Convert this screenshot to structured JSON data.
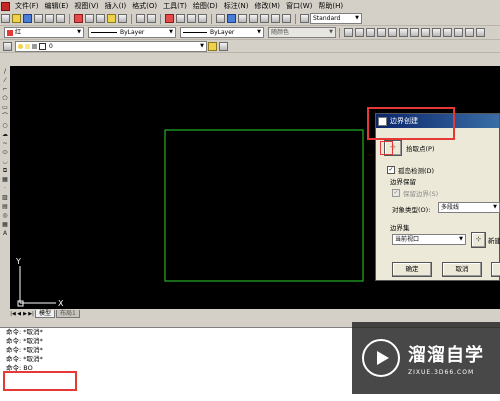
{
  "menubar": {
    "items": [
      "文件(F)",
      "编辑(E)",
      "视图(V)",
      "插入(I)",
      "格式(O)",
      "工具(T)",
      "绘图(D)",
      "标注(N)",
      "修改(M)",
      "窗口(W)",
      "帮助(H)"
    ]
  },
  "toolbar": {
    "text_style": "Standard"
  },
  "properties": {
    "color_value": "红",
    "linetype_value": "ByLayer",
    "lineweight_value": "ByLayer",
    "plotstyle_value": "随颜色"
  },
  "layers": {
    "current_layer": "0"
  },
  "ucs": {
    "x_label": "X",
    "y_label": "Y"
  },
  "tabs": {
    "model": "模型",
    "layout": "布局1"
  },
  "command_history": [
    "命令: *取消*",
    "命令: *取消*",
    "命令: *取消*",
    "命令: *取消*"
  ],
  "command_prompt": "命令: BO",
  "dialog": {
    "title": "边界创建",
    "pick_points_label": "拾取点(P)",
    "island_detection_label": "孤岛检测(D)",
    "boundary_retention_label": "边界保留",
    "retain_boundaries_label": "保留边界(S)",
    "object_type_label": "对象类型(O):",
    "object_type_value": "多段线",
    "boundary_set_label": "边界集",
    "boundary_set_value": "当前视口",
    "new_label": "新建",
    "ok_label": "确定",
    "cancel_label": "取消"
  },
  "watermark": {
    "brand": "溜溜自学",
    "url": "ZIXUE.3D66.COM"
  },
  "colors": {
    "canvas_bg": "#000000",
    "rectangle_stroke": "#2bd42b",
    "annotation_red": "#e53935",
    "title_bar": "#0a246a"
  }
}
